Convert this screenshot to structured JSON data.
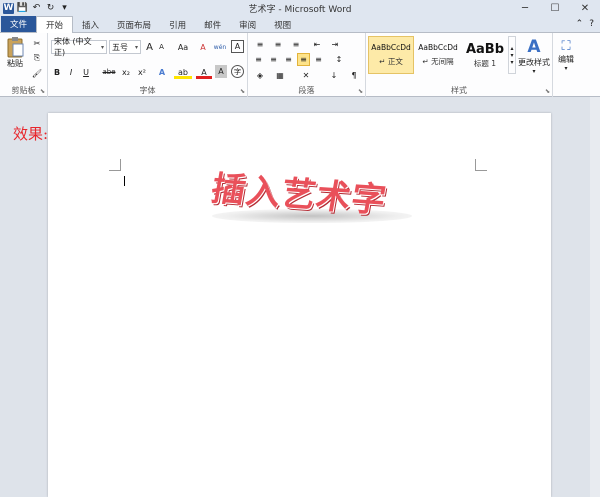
{
  "window": {
    "title": "艺术字 - Microsoft Word",
    "app_icon": "W",
    "minimize": "─",
    "maximize": "☐",
    "close": "✕"
  },
  "qat": {
    "save_icon": "💾",
    "undo_icon": "↶",
    "redo_icon": "↻",
    "customize_icon": "▾"
  },
  "tabs": {
    "file": "文件",
    "home": "开始",
    "insert": "插入",
    "layout": "页面布局",
    "references": "引用",
    "mailings": "邮件",
    "review": "审阅",
    "view": "视图",
    "help_icon": "?"
  },
  "ribbon": {
    "clipboard": {
      "label": "剪贴板",
      "paste": "粘贴",
      "cut_icon": "✂",
      "copy_icon": "⎘",
      "format_painter_icon": "🖌"
    },
    "font": {
      "label": "字体",
      "font_name": "宋体 (中文正)",
      "font_size": "五号",
      "grow": "A",
      "shrink": "A",
      "change_case": "Aa",
      "clear_format": "A",
      "phonetic": "wén",
      "border_char": "A",
      "bold": "B",
      "italic": "I",
      "underline": "U",
      "strike": "abe",
      "subscript": "x₂",
      "superscript": "x²",
      "text_effect": "A",
      "highlight": "ab",
      "font_color": "A",
      "shading": "A",
      "enclose": "字"
    },
    "paragraph": {
      "label": "段落",
      "bullets": "≡",
      "numbering": "≡",
      "multilevel": "≡",
      "decrease_indent": "⇤",
      "increase_indent": "⇥",
      "align_left": "≡",
      "center": "≡",
      "align_right": "≡",
      "justify": "≡",
      "distributed": "≡",
      "line_spacing": "↕",
      "shading": "◈",
      "borders": "▦",
      "chinese_layout": "✕",
      "sort": "↓",
      "show_marks": "¶"
    },
    "styles": {
      "label": "样式",
      "items": [
        {
          "sample": "AaBbCcDd",
          "name": "↵ 正文"
        },
        {
          "sample": "AaBbCcDd",
          "name": "↵ 无间隔"
        },
        {
          "sample": "AaBb",
          "name": "标题 1"
        }
      ],
      "change_styles": "更改样式",
      "change_styles_icon": "A"
    },
    "editing": {
      "label": "编辑",
      "icon": "⛶"
    }
  },
  "document": {
    "effect_label": "效果:",
    "wordart_text": "插入艺术字"
  }
}
